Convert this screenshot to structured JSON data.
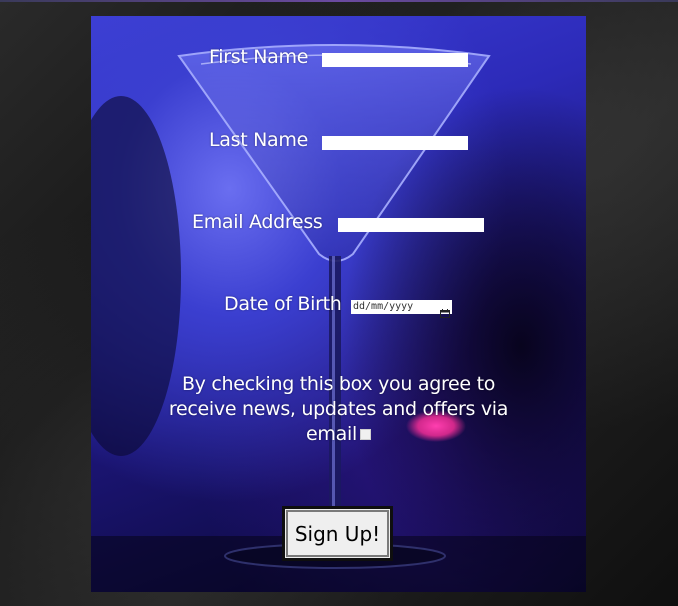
{
  "form": {
    "first_name": {
      "label": "First Name",
      "value": ""
    },
    "last_name": {
      "label": "Last Name",
      "value": ""
    },
    "email": {
      "label": "Email Address",
      "value": ""
    },
    "dob": {
      "label": "Date of Birth",
      "placeholder": "dd/mm/yyyy"
    },
    "consent_text": "By checking this box you agree to receive news, updates and offers via email",
    "consent_checked": false,
    "submit_label": "Sign Up!"
  },
  "icons": {
    "date_picker": "calendar-icon"
  },
  "colors": {
    "panel_primary": "#3d3fd8",
    "panel_dark": "#07052a",
    "label_text": "#ffffff",
    "page_background": "#1e1e1e"
  }
}
